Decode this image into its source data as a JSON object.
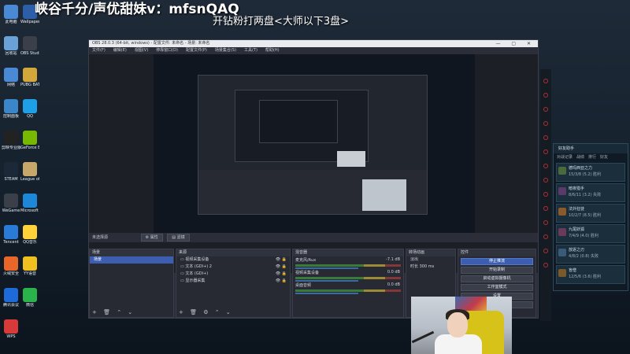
{
  "overlay": {
    "title": "峡谷千分/声优甜妹v：mfsnQAQ",
    "subtitle": "开钻粉打两盘<大师以下3盘>"
  },
  "desktop_icons": [
    {
      "label": "此电脑",
      "color": "#4a8ad4"
    },
    {
      "label": "Wallpaper Engine",
      "color": "#2c5fa8"
    },
    {
      "label": "回收站",
      "color": "#6aa2d8"
    },
    {
      "label": "OBS Studio",
      "color": "#3a3f4a"
    },
    {
      "label": "网络",
      "color": "#4a8ad4"
    },
    {
      "label": "PUBG BATTLEGR...",
      "color": "#d2a83a"
    },
    {
      "label": "控制面板",
      "color": "#3a86c8"
    },
    {
      "label": "QQ",
      "color": "#1ea0e8"
    },
    {
      "label": "剪映专业版",
      "color": "#222222"
    },
    {
      "label": "GeForce Experience",
      "color": "#76b900"
    },
    {
      "label": "STEAM",
      "color": "#1b2838"
    },
    {
      "label": "League of Legends",
      "color": "#c8a86a"
    },
    {
      "label": "WeGame",
      "color": "#3a3f4a"
    },
    {
      "label": "Microsoft Edge",
      "color": "#1e88d8"
    },
    {
      "label": "Tencent",
      "color": "#2a7ad8"
    },
    {
      "label": "QQ音乐",
      "color": "#ffd23a"
    },
    {
      "label": "火绒安全",
      "color": "#e8662a"
    },
    {
      "label": "YY语音",
      "color": "#f0c020"
    },
    {
      "label": "腾讯会议",
      "color": "#1e6ad8"
    },
    {
      "label": "微信",
      "color": "#2ab34a"
    },
    {
      "label": "WPS",
      "color": "#d83a3a"
    }
  ],
  "obs": {
    "window_title": "OBS 28.0.3 (64-bit, windows) - 配置文件: 未命名 - 场景: 未命名",
    "window_controls": "—  ▢  ✕",
    "menu": [
      "文件(F)",
      "编辑(E)",
      "视图(V)",
      "停靠窗口(D)",
      "配置文件(P)",
      "场景集合(S)",
      "工具(T)",
      "帮助(H)"
    ],
    "status_label": "未选择源",
    "properties_button": "属性",
    "filters_button": "滤镜",
    "scenes": {
      "header": "场景",
      "items": [
        "场景"
      ]
    },
    "sources": {
      "header": "来源",
      "items": [
        "视频采集设备",
        "文本 (GDI+) 2",
        "文本 (GDI+)",
        "显示器采集"
      ]
    },
    "mixer": {
      "header": "混音器",
      "channels": [
        {
          "name": "麦克风/Aux",
          "db": "-7.1 dB"
        },
        {
          "name": "视频采集设备",
          "db": "0.0 dB"
        },
        {
          "name": "桌面音频",
          "db": "0.0 dB"
        }
      ]
    },
    "transitions": {
      "header": "转场动画",
      "type": "淡出",
      "duration_label": "时长",
      "duration": "300 ms"
    },
    "controls": {
      "header": "控件",
      "buttons": [
        "停止推流",
        "开始录制",
        "启动虚拟摄像机",
        "工作室模式",
        "设置",
        "退出"
      ]
    }
  },
  "game_panel": {
    "title": "好友助手",
    "tabs": [
      "对战记录",
      "战绩",
      "排行",
      "好友"
    ],
    "rows": [
      {
        "name": "德玛西亚之力",
        "stat": "15/3/8 (5.2) 胜利",
        "color": "#4a6a3a"
      },
      {
        "name": "暗夜猎手",
        "stat": "8/6/11 (3.2) 失败",
        "color": "#5a3a6a"
      },
      {
        "name": "法外狂徒",
        "stat": "10/2/7 (8.5) 胜利",
        "color": "#8a5a2a"
      },
      {
        "name": "九尾妖狐",
        "stat": "7/4/9 (4.0) 胜利",
        "color": "#6a3a5a"
      },
      {
        "name": "放逐之刃",
        "stat": "4/8/2 (0.8) 失败",
        "color": "#3a5a7a"
      },
      {
        "name": "盲僧",
        "stat": "12/5/6 (3.6) 胜利",
        "color": "#7a5a2a"
      }
    ]
  }
}
